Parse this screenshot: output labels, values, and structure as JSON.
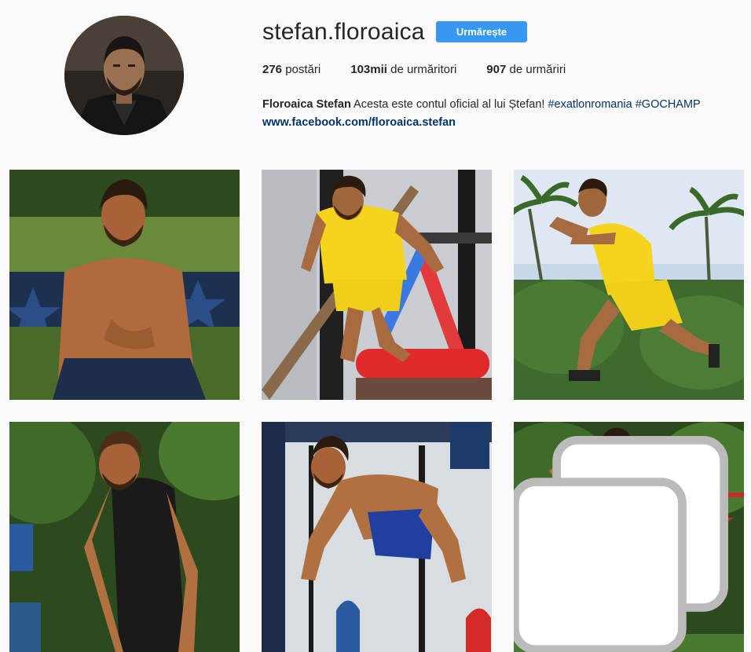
{
  "profile": {
    "username": "stefan.floroaica",
    "follow_label": "Urmărește",
    "stats": {
      "posts_count": "276",
      "posts_label": " postări",
      "followers_count": "103mii",
      "followers_label": " de urmăritori",
      "following_count": "907",
      "following_label": " de urmăriri"
    },
    "bio": {
      "full_name": "Floroaica Stefan",
      "text": " Acesta este contul oficial al lui Ștefan! ",
      "hashtag1": "#exatlonromania",
      "hashtag2": "#GOCHAMP",
      "website": "www.facebook.com/floroaica.stefan"
    }
  },
  "colors": {
    "accent": "#3897f0",
    "link": "#003569",
    "shirt_yellow": "#f5d21a",
    "shorts_blue": "#1f3f8a"
  },
  "posts": [
    {
      "id": "post-1",
      "subject": "shirtless athlete sitting on grass"
    },
    {
      "id": "post-2",
      "subject": "athlete in yellow running on obstacle"
    },
    {
      "id": "post-3",
      "subject": "athlete in yellow leaping among palms"
    },
    {
      "id": "post-4",
      "subject": "athlete in black tank top"
    },
    {
      "id": "post-5",
      "subject": "shirtless athlete at obstacle course"
    },
    {
      "id": "post-6",
      "subject": "athlete with headband mid-stride",
      "multiple": true,
      "icon": "multiple-photos-icon"
    }
  ]
}
